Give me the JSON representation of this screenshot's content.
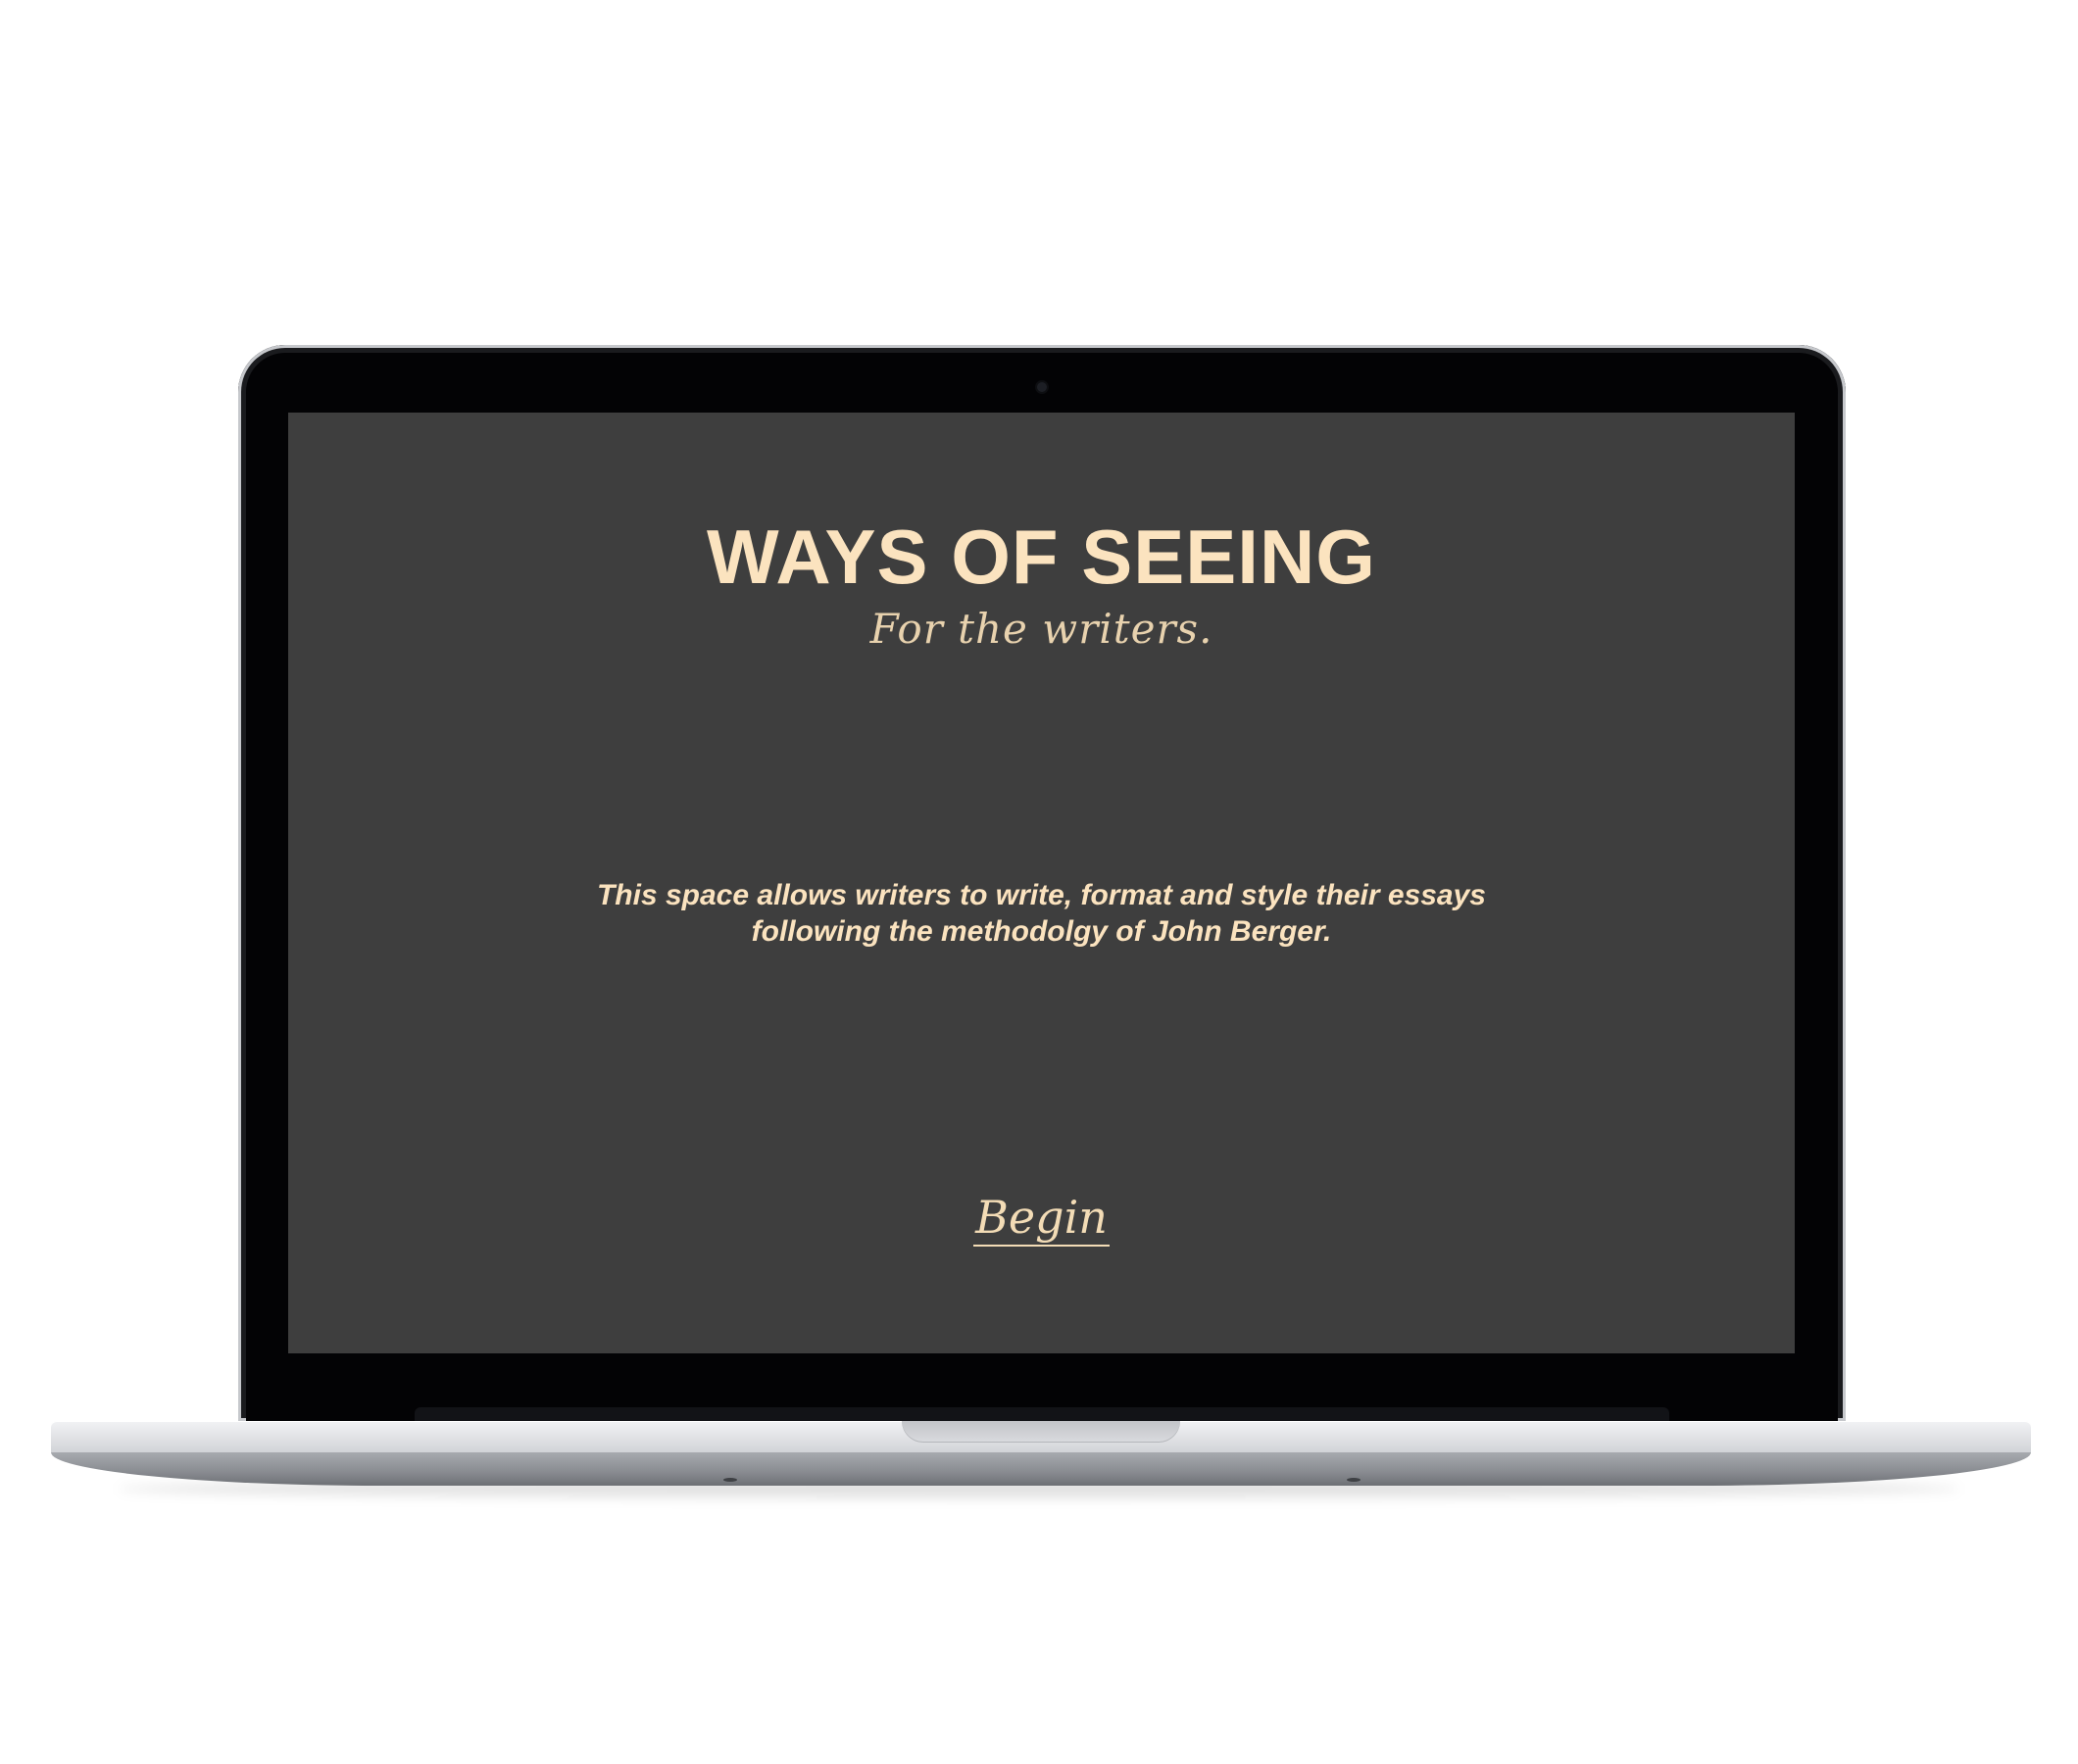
{
  "app": {
    "title": "WAYS OF SEEING",
    "subtitle": "For the writers.",
    "description": "This space allows writers to write, format and style their essays following the methodolgy of John Berger.",
    "begin_label": "Begin"
  },
  "colors": {
    "screen_background": "#3e3e3e",
    "accent_text": "#fbe3bf",
    "page_background": "#ffffff"
  }
}
